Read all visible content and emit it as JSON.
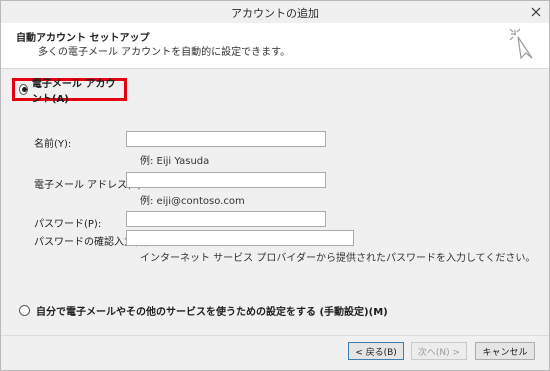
{
  "window": {
    "title": "アカウントの追加"
  },
  "header": {
    "title": "自動アカウント セットアップ",
    "subtitle": "多くの電子メール アカウントを自動的に設定できます。",
    "icon": "wizard-sparkle-icon"
  },
  "auto_option": {
    "label": "電子メール アカウント(A)",
    "checked": true
  },
  "fields": {
    "name": {
      "label": "名前(Y):",
      "value": "",
      "hint": "例: Eiji Yasuda"
    },
    "email": {
      "label": "電子メール アドレス(E):",
      "value": "",
      "hint": "例: eiji@contoso.com"
    },
    "password": {
      "label": "パスワード(P):",
      "value": ""
    },
    "password_confirm": {
      "label": "パスワードの確認入力(T):",
      "value": "",
      "hint": "インターネット サービス プロバイダーから提供されたパスワードを入力してください。"
    }
  },
  "manual_option": {
    "label": "自分で電子メールやその他のサービスを使うための設定をする (手動設定)(M)",
    "checked": false
  },
  "buttons": {
    "back": "< 戻る(B)",
    "next": "次へ(N) >",
    "cancel": "キャンセル"
  },
  "colors": {
    "highlight": "#e3000f"
  }
}
